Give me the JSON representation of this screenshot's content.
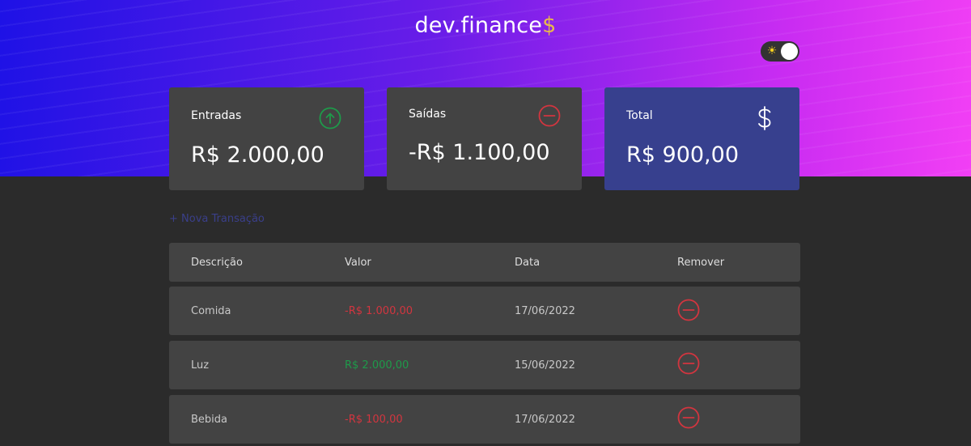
{
  "header": {
    "logo_text": "dev.finance",
    "logo_symbol": "$",
    "theme_toggle_icon": "sun-icon"
  },
  "cards": {
    "income": {
      "label": "Entradas",
      "value": "R$ 2.000,00",
      "icon": "arrow-up-circle-icon",
      "color": "#1e9a4a"
    },
    "expense": {
      "label": "Saídas",
      "value": "-R$ 1.100,00",
      "icon": "minus-circle-icon",
      "color": "#d2353f"
    },
    "total": {
      "label": "Total",
      "value": "R$ 900,00",
      "icon": "dollar-icon",
      "color": "#37408e"
    }
  },
  "new_transaction_label": "+ Nova Transação",
  "table": {
    "headers": [
      "Descrição",
      "Valor",
      "Data",
      "Remover"
    ],
    "rows": [
      {
        "description": "Comida",
        "amount": "-R$ 1.000,00",
        "date": "17/06/2022",
        "type": "expense"
      },
      {
        "description": "Luz",
        "amount": "R$ 2.000,00",
        "date": "15/06/2022",
        "type": "income"
      },
      {
        "description": "Bebida",
        "amount": "-R$ 100,00",
        "date": "17/06/2022",
        "type": "expense"
      }
    ]
  },
  "colors": {
    "income": "#1e9a4a",
    "expense": "#d2353f",
    "accent": "#37408e",
    "brand_symbol": "#e8b94a"
  }
}
